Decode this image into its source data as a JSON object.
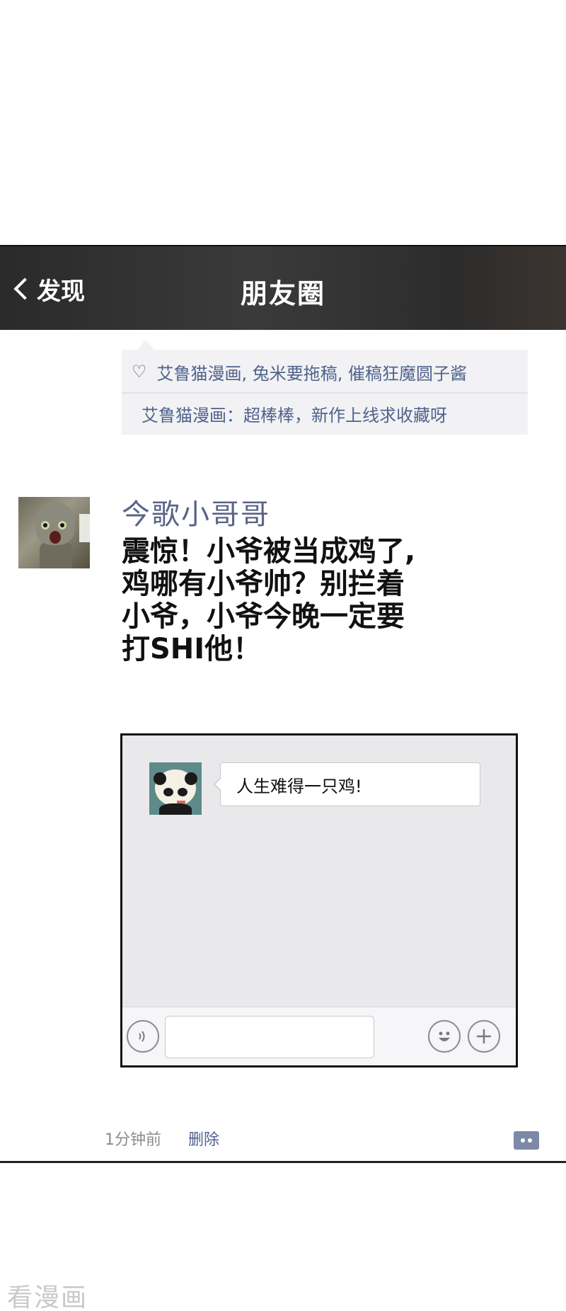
{
  "navbar": {
    "back_label": "发现",
    "title": "朋友圈"
  },
  "comments": {
    "likes": "艾鲁猫漫画, 兔米要拖稿, 催稿狂魔圆子酱",
    "comment_author": "艾鲁猫漫画",
    "comment_separator": "：",
    "comment_text": "超棒棒，新作上线求收藏呀"
  },
  "post": {
    "author": "今歌小哥哥",
    "body_lines": [
      "震惊！小爷被当成鸡了,",
      "鸡哪有小爷帅？别拦着",
      "小爷，小爷今晚一定要",
      "打SHI他！"
    ],
    "time": "1分钟前",
    "delete_label": "删除"
  },
  "chat_screenshot": {
    "message": "人生难得一只鸡!"
  },
  "watermark": "看漫画",
  "icons": {
    "back": "chevron-left-icon",
    "like": "heart-icon",
    "voice": "voice-icon",
    "emoji": "emoji-icon",
    "plus": "plus-icon",
    "comment": "comment-icon"
  },
  "colors": {
    "navbar": "#2e2e2e",
    "link_blue": "#50628c",
    "comment_bg": "#f2f2f4"
  }
}
